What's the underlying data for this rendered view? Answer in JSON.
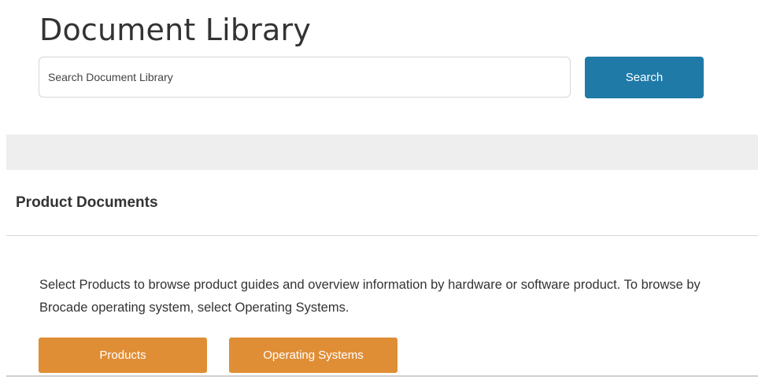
{
  "header": {
    "title": "Document Library"
  },
  "search": {
    "placeholder": "Search Document Library",
    "value": "",
    "button_label": "Search"
  },
  "section": {
    "heading": "Product Documents",
    "description": "Select Products to browse product guides and overview information by hardware or software product. To browse by Brocade operating system, select Operating Systems."
  },
  "actions": {
    "products_label": "Products",
    "operating_systems_label": "Operating Systems"
  },
  "colors": {
    "search_button": "#1f7aa8",
    "action_button": "#e08e36",
    "band": "#eeeeee"
  }
}
